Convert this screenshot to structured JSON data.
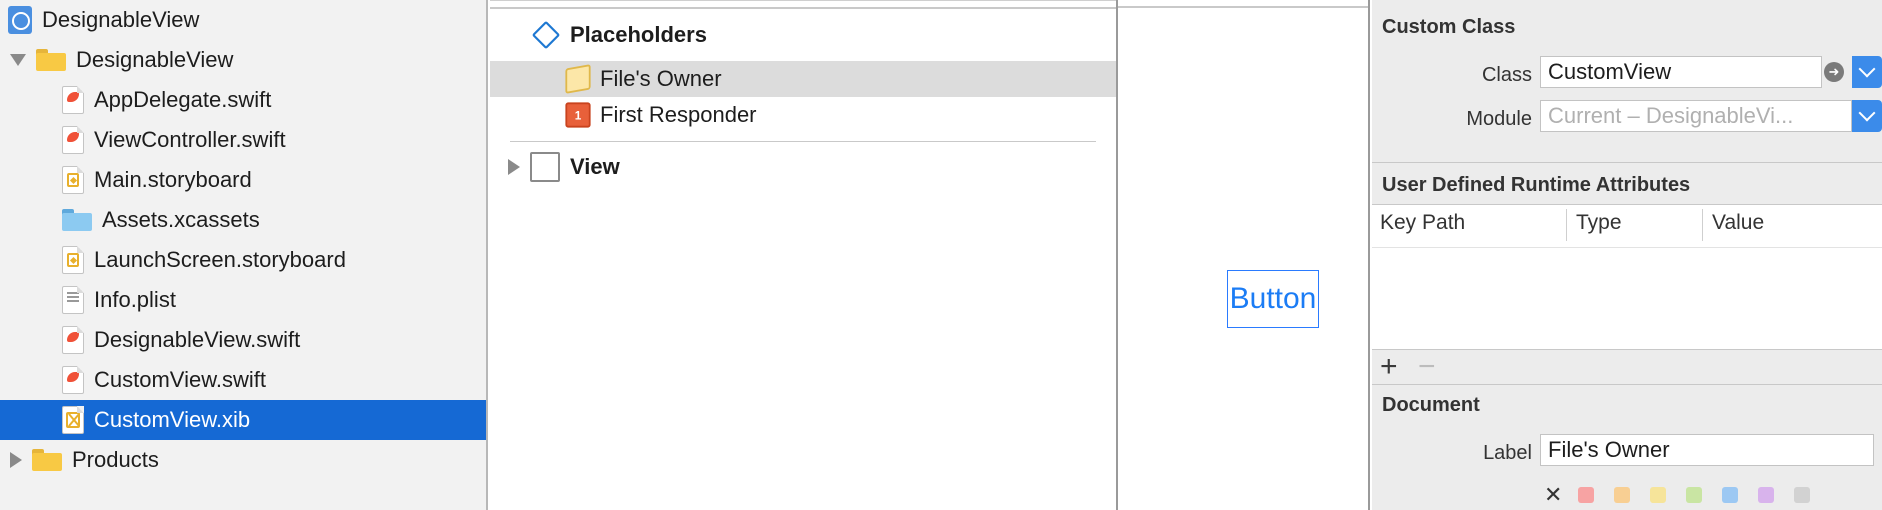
{
  "navigator": {
    "items": [
      {
        "label": "DesignableView",
        "kind": "project",
        "disclosure": "none",
        "indent": 0,
        "selected": false
      },
      {
        "label": "DesignableView",
        "kind": "folder",
        "disclosure": "open",
        "indent": 1,
        "selected": false
      },
      {
        "label": "AppDelegate.swift",
        "kind": "swift",
        "indent": 2,
        "selected": false
      },
      {
        "label": "ViewController.swift",
        "kind": "swift",
        "indent": 2,
        "selected": false
      },
      {
        "label": "Main.storyboard",
        "kind": "storyboard",
        "indent": 2,
        "selected": false
      },
      {
        "label": "Assets.xcassets",
        "kind": "assets",
        "indent": 2,
        "selected": false
      },
      {
        "label": "LaunchScreen.storyboard",
        "kind": "storyboard",
        "indent": 2,
        "selected": false
      },
      {
        "label": "Info.plist",
        "kind": "plist",
        "indent": 2,
        "selected": false
      },
      {
        "label": "DesignableView.swift",
        "kind": "swift",
        "indent": 2,
        "selected": false
      },
      {
        "label": "CustomView.swift",
        "kind": "swift",
        "indent": 2,
        "selected": false
      },
      {
        "label": "CustomView.xib",
        "kind": "xib",
        "indent": 2,
        "selected": true
      },
      {
        "label": "Products",
        "kind": "folder",
        "disclosure": "closed",
        "indent": 1,
        "selected": false
      }
    ]
  },
  "outline": {
    "placeholders_label": "Placeholders",
    "files_owner_label": "File's Owner",
    "first_responder_label": "First Responder",
    "first_responder_badge": "1",
    "view_label": "View"
  },
  "canvas": {
    "button_label": "Button"
  },
  "inspector": {
    "custom_class": {
      "title": "Custom Class",
      "class_label": "Class",
      "class_value": "CustomView",
      "module_label": "Module",
      "module_placeholder": "Current – DesignableVi..."
    },
    "runtime_attributes": {
      "title": "User Defined Runtime Attributes",
      "columns": [
        "Key Path",
        "Type",
        "Value"
      ],
      "add_label": "+",
      "remove_label": "−"
    },
    "document": {
      "title": "Document",
      "label_label": "Label",
      "label_value": "File's Owner",
      "clear_label": "✕",
      "swatches": [
        "#f7a3a3",
        "#f8cf93",
        "#f6e49a",
        "#c9e5a3",
        "#9cc8f3",
        "#d8b3ec",
        "#d2d2d2"
      ]
    }
  },
  "icons": {
    "project": "project-icon",
    "folder": "folder-icon",
    "swift": "swift-file-icon",
    "storyboard": "storyboard-icon",
    "assets": "asset-catalog-icon",
    "plist": "plist-icon",
    "xib": "xib-icon"
  }
}
